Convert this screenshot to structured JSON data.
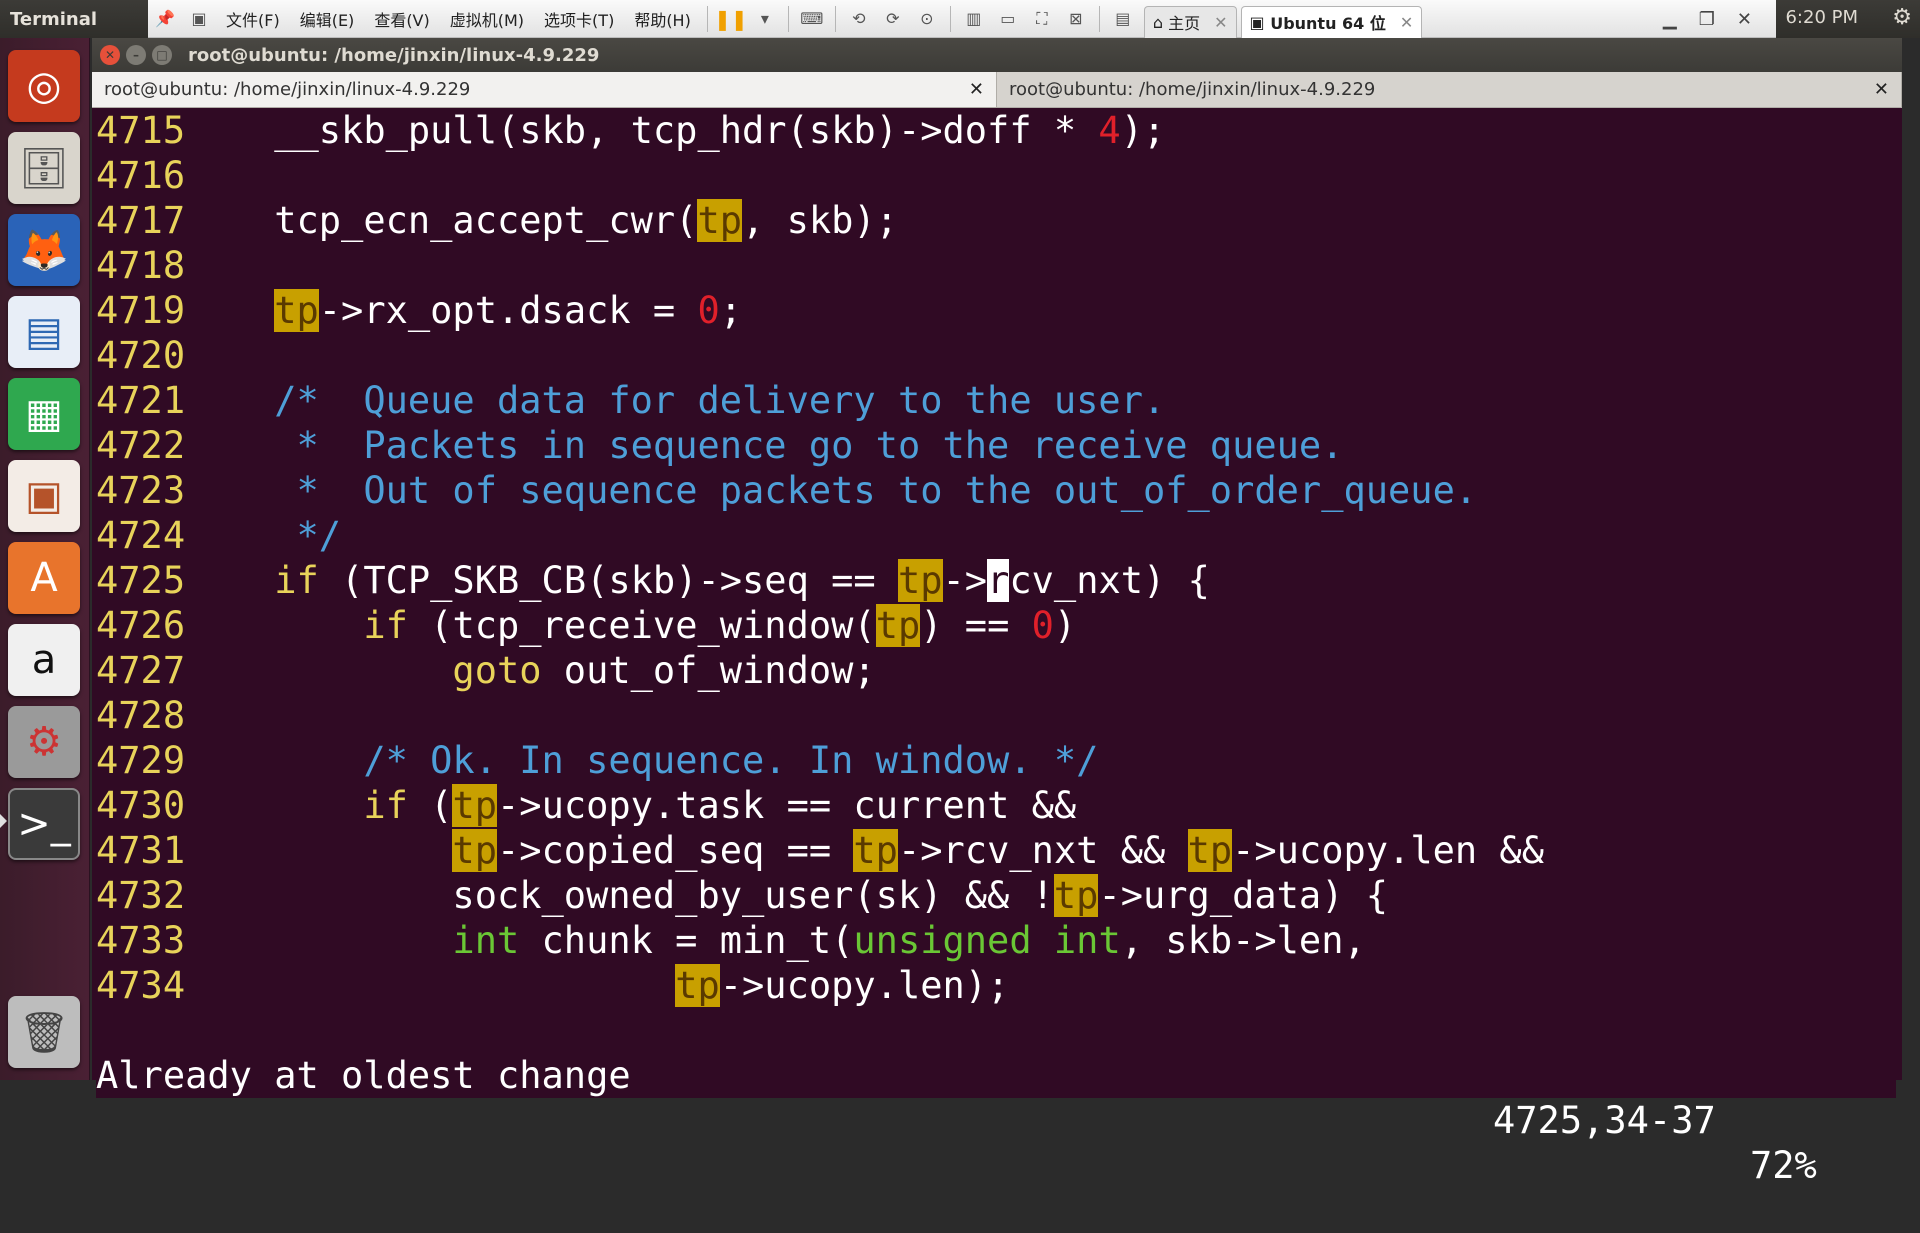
{
  "topbar": {
    "app_title": "Terminal",
    "clock": "6:20 PM",
    "menus": [
      "文件(F)",
      "编辑(E)",
      "查看(V)",
      "虚拟机(M)",
      "选项卡(T)",
      "帮助(H)"
    ],
    "vm_tabs": [
      {
        "label": "主页",
        "active": false
      },
      {
        "label": "Ubuntu 64 位",
        "active": true
      }
    ]
  },
  "launcher": {
    "items": [
      "ubuntu-dash",
      "files",
      "firefox",
      "writer",
      "calc",
      "impress",
      "software-center",
      "amazon",
      "system-settings",
      "terminal",
      "trash"
    ]
  },
  "window": {
    "title": "root@ubuntu: /home/jinxin/linux-4.9.229",
    "tabs": [
      {
        "label": "root@ubuntu: /home/jinxin/linux-4.9.229",
        "active": true
      },
      {
        "label": "root@ubuntu: /home/jinxin/linux-4.9.229",
        "active": false
      }
    ]
  },
  "editor": {
    "lines": [
      {
        "num": "4715",
        "text": "    __skb_pull(skb, tcp_hdr(skb)->doff * 4);"
      },
      {
        "num": "4716",
        "text": ""
      },
      {
        "num": "4717",
        "text": "    tcp_ecn_accept_cwr(tp, skb);"
      },
      {
        "num": "4718",
        "text": ""
      },
      {
        "num": "4719",
        "text": "    tp->rx_opt.dsack = 0;"
      },
      {
        "num": "4720",
        "text": ""
      },
      {
        "num": "4721",
        "text": "    /*  Queue data for delivery to the user."
      },
      {
        "num": "4722",
        "text": "     *  Packets in sequence go to the receive queue."
      },
      {
        "num": "4723",
        "text": "     *  Out of sequence packets to the out_of_order_queue."
      },
      {
        "num": "4724",
        "text": "     */"
      },
      {
        "num": "4725",
        "text": "    if (TCP_SKB_CB(skb)->seq == tp->rcv_nxt) {"
      },
      {
        "num": "4726",
        "text": "        if (tcp_receive_window(tp) == 0)"
      },
      {
        "num": "4727",
        "text": "            goto out_of_window;"
      },
      {
        "num": "4728",
        "text": ""
      },
      {
        "num": "4729",
        "text": "        /* Ok. In sequence. In window. */"
      },
      {
        "num": "4730",
        "text": "        if (tp->ucopy.task == current &&"
      },
      {
        "num": "4731",
        "text": "            tp->copied_seq == tp->rcv_nxt && tp->ucopy.len &&"
      },
      {
        "num": "4732",
        "text": "            sock_owned_by_user(sk) && !tp->urg_data) {"
      },
      {
        "num": "4733",
        "text": "            int chunk = min_t(unsigned int, skb->len,"
      },
      {
        "num": "4734",
        "text": "                      tp->ucopy.len);"
      }
    ],
    "status_message": "Already at oldest change",
    "cursor_position": "4725,34-37",
    "scroll_percent": "72%",
    "search_highlight": "tp"
  },
  "colors": {
    "terminal_bg": "#300a24",
    "line_number": "#e8d35a",
    "keyword": "#e8d35a",
    "comment": "#4e9fd8",
    "number": "#e0202a",
    "type": "#6ac735",
    "search_highlight": "#c8a000"
  }
}
